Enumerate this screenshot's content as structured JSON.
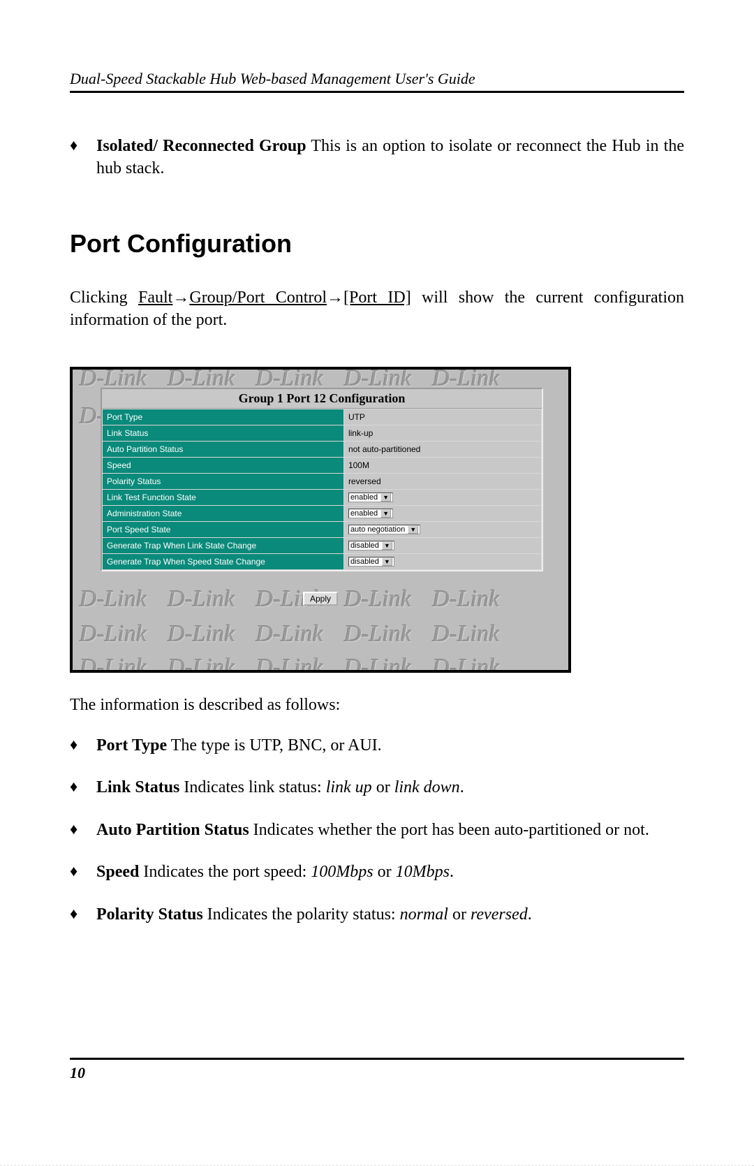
{
  "header": "Dual-Speed Stackable Hub Web-based Management User's Guide",
  "top_bullet": {
    "term": "Isolated/ Reconnected Group",
    "text": "   This is an option to isolate or reconnect the Hub in the hub stack."
  },
  "section_title": "Port Configuration",
  "intro": {
    "pre": "Clicking ",
    "nav1": "Fault",
    "nav2": "Group/Port Control",
    "nav3": "[Port ID]",
    "post": " will show the current configuration information of the port."
  },
  "figure": {
    "watermark": "D-Link",
    "panel_title": "Group 1 Port 12 Configuration",
    "rows": [
      {
        "label": "Port Type",
        "value": "UTP",
        "type": "text"
      },
      {
        "label": "Link Status",
        "value": "link-up",
        "type": "text"
      },
      {
        "label": "Auto Partition Status",
        "value": "not auto-partitioned",
        "type": "text"
      },
      {
        "label": "Speed",
        "value": "100M",
        "type": "text"
      },
      {
        "label": "Polarity Status",
        "value": "reversed",
        "type": "text"
      },
      {
        "label": "Link Test Function State",
        "value": "enabled",
        "type": "select"
      },
      {
        "label": "Administration State",
        "value": "enabled",
        "type": "select"
      },
      {
        "label": "Port Speed State",
        "value": "auto negotiation",
        "type": "select"
      },
      {
        "label": "Generate Trap When Link State Change",
        "value": "disabled",
        "type": "select"
      },
      {
        "label": "Generate Trap When Speed State Change",
        "value": "disabled",
        "type": "select"
      }
    ],
    "apply": "Apply"
  },
  "after_figure": "The information is described as follows:",
  "bullets": [
    {
      "term": "Port Type",
      "plain": "   The type is UTP, BNC, or AUI."
    },
    {
      "term": "Link Status",
      "plain": "   Indicates link status:  ",
      "ital": "link up",
      "mid": " or ",
      "ital2": "link down",
      "tail": "."
    },
    {
      "term": "Auto Partition Status",
      "plain": "    Indicates whether the port has been auto-partitioned or not."
    },
    {
      "term": "Speed",
      "plain": "   Indicates the port speed:  ",
      "ital": "100Mbps",
      "mid": " or ",
      "ital2": "10Mbps",
      "tail": "."
    },
    {
      "term": "Polarity Status",
      "plain": "   Indicates the polarity status:  ",
      "ital": "normal",
      "mid": " or ",
      "ital2": "reversed",
      "tail": "."
    }
  ],
  "page_number": "10"
}
